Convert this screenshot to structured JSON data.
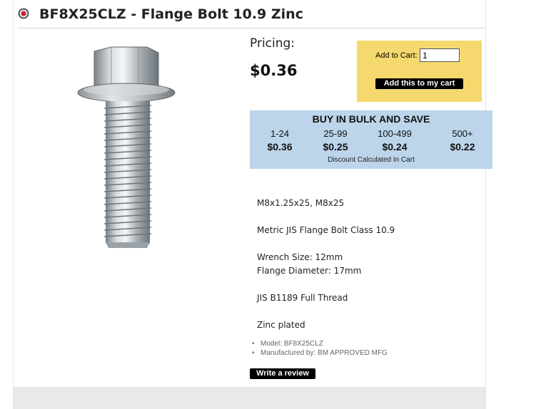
{
  "product": {
    "title": "BF8X25CLZ - Flange Bolt 10.9 Zinc"
  },
  "pricing": {
    "label": "Pricing:",
    "price": "$0.36"
  },
  "cart": {
    "label": "Add to Cart:",
    "quantity": "1",
    "button_label": "Add this to my cart",
    "background_color": "#f5d96e"
  },
  "bulk": {
    "title": "BUY IN BULK AND SAVE",
    "tiers": [
      {
        "range": "1-24",
        "price": "$0.36"
      },
      {
        "range": "25-99",
        "price": "$0.25"
      },
      {
        "range": "100-499",
        "price": "$0.24"
      },
      {
        "range": "500+",
        "price": "$0.22"
      }
    ],
    "note": "Discount Calculated In Cart",
    "background_color": "#bcd5ea"
  },
  "description": [
    "M8x1.25x25, M8x25",
    "Metric JIS Flange Bolt Class 10.9",
    "Wrench Size: 12mm",
    "Flange Diameter: 17mm",
    "JIS B1189 Full Thread",
    "Zinc plated"
  ],
  "meta": {
    "model": "Model: BF8X25CLZ",
    "manufacturer": "Manufactured by: BM APPROVED MFG"
  },
  "review": {
    "button_label": "Write a review"
  }
}
